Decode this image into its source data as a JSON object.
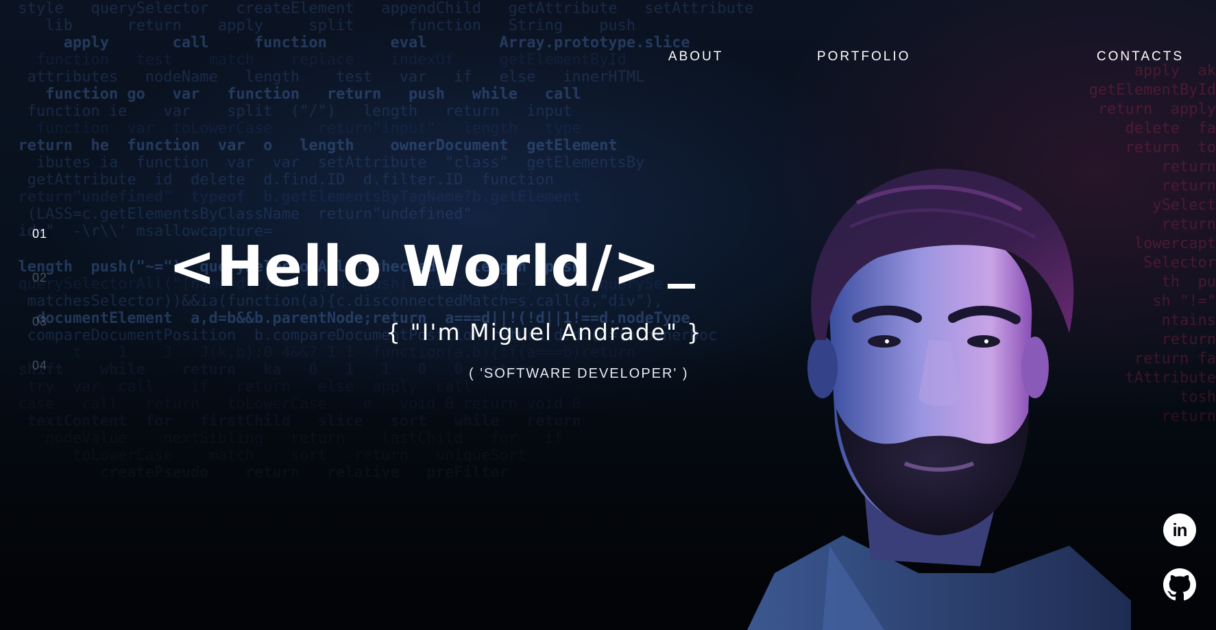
{
  "nav": {
    "about": "ABOUT",
    "portfolio": "PORTFOLIO",
    "contacts": "CONTACTS"
  },
  "side_index": [
    "01",
    "02",
    "03",
    "04"
  ],
  "side_index_active": "01",
  "hero": {
    "title": "<Hello World/>",
    "cursor": "_",
    "name": "{ \"I'm Miguel Andrade\" }",
    "role": "( 'SOFTWARE DEVELOPER' )"
  },
  "social": {
    "linkedin_icon": "linkedin-icon",
    "github_icon": "github-icon"
  },
  "colors": {
    "background": "#05070d",
    "text": "#ffffff",
    "code_blue": "#3c5fa0",
    "code_red": "#aa2850",
    "portrait_tint": "#7a5ad0"
  }
}
